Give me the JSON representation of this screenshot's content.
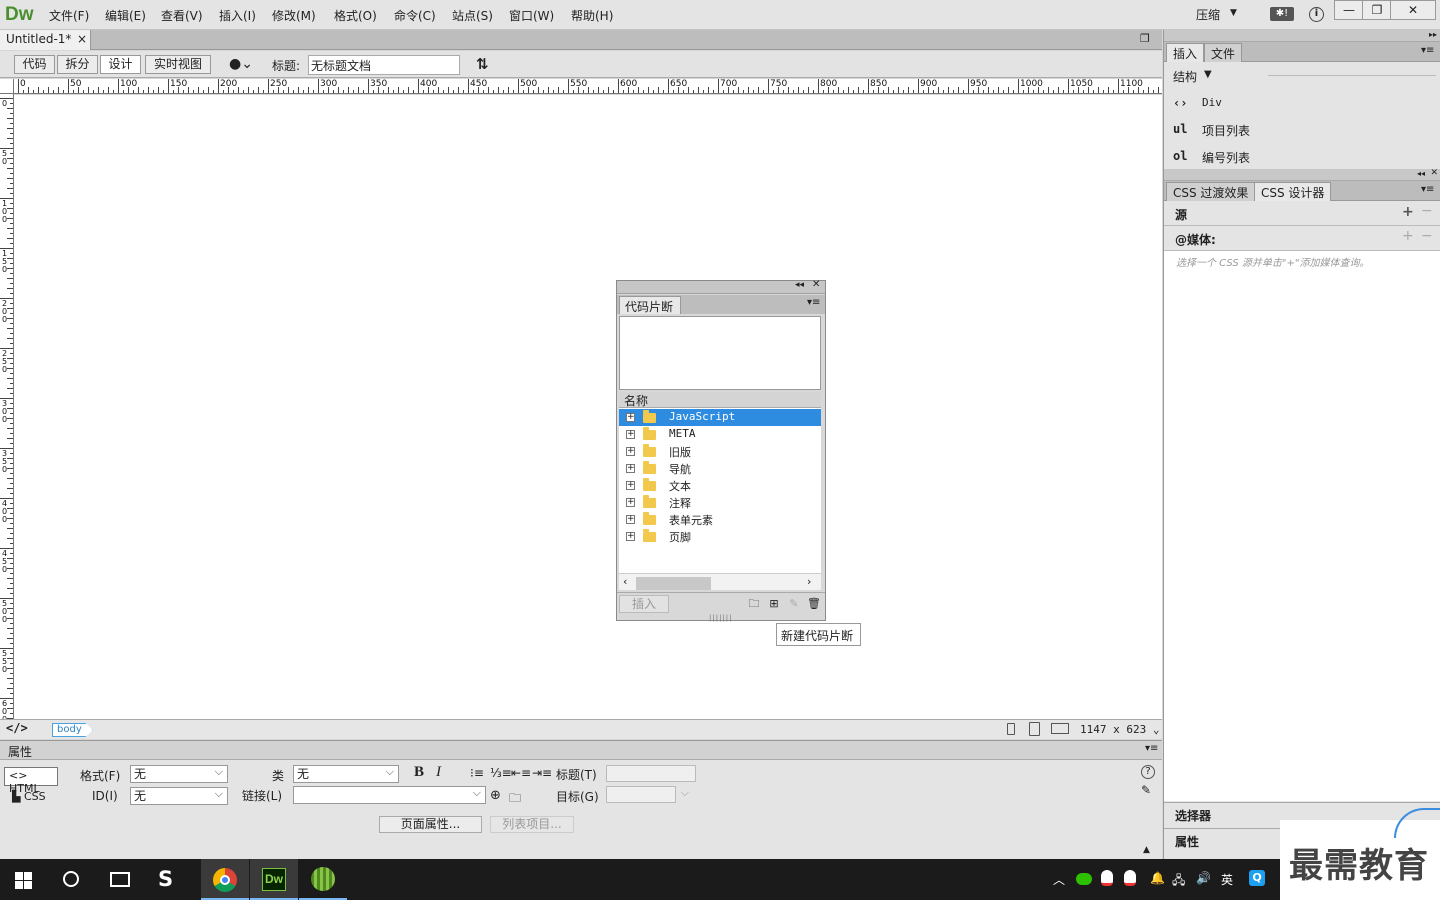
{
  "app": {
    "logo": "Dw",
    "menus": [
      "文件(F)",
      "编辑(E)",
      "查看(V)",
      "插入(I)",
      "修改(M)",
      "格式(O)",
      "命令(C)",
      "站点(S)",
      "窗口(W)",
      "帮助(H)"
    ],
    "workspace": "压缩",
    "window_controls": {
      "minimize": "—",
      "restore": "❐",
      "close": "✕"
    }
  },
  "document": {
    "tab_name": "Untitled-1*",
    "tab_close": "×",
    "views": [
      "代码",
      "拆分",
      "设计",
      "实时视图"
    ],
    "active_view": "设计",
    "title_label": "标题:",
    "title_value": "无标题文档"
  },
  "ruler": {
    "h_labels": [
      "0",
      "50",
      "100",
      "150",
      "200",
      "250",
      "300",
      "350",
      "400",
      "450",
      "500",
      "550",
      "600",
      "650",
      "700",
      "750",
      "800",
      "850",
      "900",
      "950",
      "1000",
      "1050",
      "1100"
    ],
    "v_labels": [
      "0",
      "50",
      "100",
      "150",
      "200",
      "250",
      "300",
      "350",
      "400",
      "450",
      "500",
      "550",
      "600"
    ]
  },
  "snippets": {
    "tab": "代码片断",
    "column_header": "名称",
    "folders": [
      {
        "name": "JavaScript",
        "selected": true
      },
      {
        "name": "META",
        "selected": false
      },
      {
        "name": "旧版",
        "selected": false
      },
      {
        "name": "导航",
        "selected": false
      },
      {
        "name": "文本",
        "selected": false
      },
      {
        "name": "注释",
        "selected": false
      },
      {
        "name": "表单元素",
        "selected": false
      },
      {
        "name": "页脚",
        "selected": false
      }
    ],
    "insert_button": "插入",
    "tooltip": "新建代码片断"
  },
  "statusbar": {
    "tag": "body",
    "dimensions": "1147 x 623"
  },
  "properties": {
    "header": "属性",
    "html_button": "HTML",
    "css_button": "CSS",
    "format_label": "格式(F)",
    "format_value": "无",
    "id_label": "ID(I)",
    "id_value": "无",
    "class_label": "类",
    "class_value": "无",
    "link_label": "链接(L)",
    "link_value": "",
    "bold": "B",
    "italic": "I",
    "title_label": "标题(T)",
    "target_label": "目标(G)",
    "page_props_button": "页面属性...",
    "list_item_button": "列表项目..."
  },
  "right_panel": {
    "insert_tabs": [
      "插入",
      "文件"
    ],
    "insert_category": "结构",
    "insert_items": [
      {
        "icon": "‹›",
        "label": "Div"
      },
      {
        "icon": "ul",
        "label": "项目列表"
      },
      {
        "icon": "ol",
        "label": "编号列表"
      }
    ],
    "css_tabs": [
      "CSS 过渡效果",
      "CSS 设计器"
    ],
    "source_title": "源",
    "media_title": "@媒体:",
    "media_hint": "选择一个 CSS 源并单击\"+\"添加媒体查询。",
    "selectors_title": "选择器",
    "properties_title": "属性"
  },
  "watermark": "最需教育",
  "taskbar": {
    "ime": "英",
    "tray_q": "Q"
  },
  "colors": {
    "selection": "#2e8ce0",
    "logo": "#4a8f2e",
    "tag_border": "#4aa3df"
  }
}
